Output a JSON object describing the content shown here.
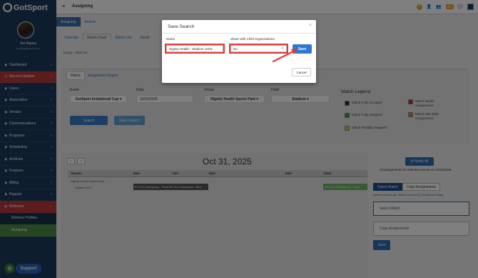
{
  "brand": {
    "name": "GotSport"
  },
  "user": {
    "name": "Joe Agues",
    "email": "joe@gotsport.com"
  },
  "sidebar": {
    "items": [
      {
        "label": "Dashboard",
        "icon": "dashboard-icon",
        "glyph": "◉"
      },
      {
        "label": "Recent Updates",
        "icon": "updates-icon",
        "glyph": "◎"
      },
      {
        "label": "Users",
        "icon": "users-icon",
        "glyph": "◉"
      },
      {
        "label": "Association",
        "icon": "association-icon",
        "glyph": "◉"
      },
      {
        "label": "Venues",
        "icon": "venues-icon",
        "glyph": "◉"
      },
      {
        "label": "Communications",
        "icon": "communications-icon",
        "glyph": "◉"
      },
      {
        "label": "Programs",
        "icon": "programs-icon",
        "glyph": "◉"
      },
      {
        "label": "Scheduling",
        "icon": "scheduling-icon",
        "glyph": "◉"
      },
      {
        "label": "Archives",
        "icon": "archives-icon",
        "glyph": "◉"
      },
      {
        "label": "Features",
        "icon": "features-icon",
        "glyph": "◉"
      },
      {
        "label": "Billing",
        "icon": "billing-icon",
        "glyph": "◉"
      },
      {
        "label": "Reports",
        "icon": "reports-icon",
        "glyph": "◉"
      },
      {
        "label": "Referees",
        "icon": "referees-icon",
        "glyph": "◉"
      }
    ],
    "sub_items": [
      {
        "label": "Referee Profiles"
      },
      {
        "label": "Assigning"
      }
    ],
    "support_label": "Support"
  },
  "topbar": {
    "title": "Assigning",
    "badge": "99+"
  },
  "tabs_primary": [
    {
      "label": "Assigning"
    },
    {
      "label": "Events"
    }
  ],
  "tabs_secondary": [
    {
      "label": "Calendar"
    },
    {
      "label": "Match Chart"
    },
    {
      "label": "Match List"
    },
    {
      "label": "Detail"
    }
  ],
  "breadcrumb": {
    "a": "Assign",
    "sep": "›",
    "b": "Matches"
  },
  "filters": {
    "tabs": [
      {
        "label": "Filters"
      },
      {
        "label": "Assignment Report"
      }
    ],
    "event": {
      "label": "Event",
      "value": "GotSport Invitational Cup ▾"
    },
    "date": {
      "label": "Date",
      "value": "10/31/2025"
    },
    "venue": {
      "label": "Venue",
      "value": "Dignity Health Sports Park ▾"
    },
    "field": {
      "label": "Field",
      "value": "Stadium ▾"
    },
    "search_label": "Search",
    "save_search_label": "Save Search"
  },
  "legend": {
    "title": "Match Legend",
    "items": [
      {
        "label": "Match Fully Accepted",
        "color": "#1a3a24"
      },
      {
        "label": "Match Fully Assigned",
        "color": "#3d9a3d"
      },
      {
        "label": "Match Partially Assigned",
        "color": "#d6c734"
      },
      {
        "label": "Match Needs Assignments",
        "color": "#c0392b"
      },
      {
        "label": "Match Has Stale Assignments",
        "color": "#e67e22"
      }
    ]
  },
  "schedule": {
    "date_title": "Oct 31, 2025",
    "venues_header": "Venues",
    "hours": [
      "8am",
      "7am",
      "8am",
      "9am",
      "10am"
    ],
    "venue_name": "Dignity Health Sports Park",
    "field_name": "Stadium PDT",
    "games": [
      {
        "label": "#7 U12 Champions - Final  #8 U12 Champions - Best",
        "color": "#555555"
      },
      {
        "label": "#10 U12 Champions - Final",
        "color": "#6fb56a"
      }
    ]
  },
  "right_panel": {
    "notify_label": "Notify All",
    "all_assignments": "All assignments for selected events on 10/31/2025",
    "tabs": [
      {
        "label": "Select Match"
      },
      {
        "label": "Copy Assignments"
      }
    ],
    "note": "Referee includes age, Referee Level (A-E), and Referee Rating",
    "select_match": "Select Match",
    "copy_assignments": "Copy Assignments",
    "save_label": "Save"
  },
  "modal": {
    "title": "Save Search",
    "close": "×",
    "name_label": "Name",
    "name_value": "Dignity Health - Stadium 10/31",
    "share_label": "Share with Child Organizations",
    "share_value": "No",
    "save_label": "Save",
    "cancel_label": "Cancel",
    "highlight_color": "#e53935"
  }
}
